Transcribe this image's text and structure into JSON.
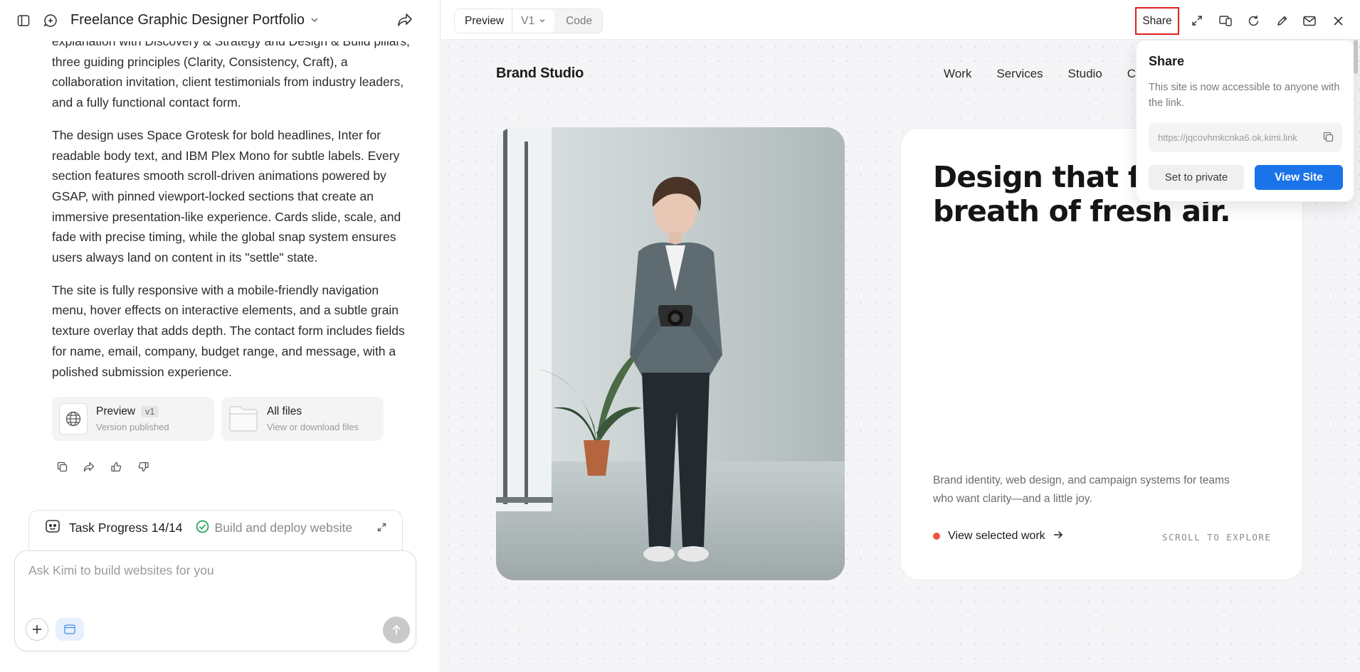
{
  "project": {
    "title": "Freelance Graphic Designer Portfolio"
  },
  "chat": {
    "paragraphs": [
      "explanation with Discovery & Strategy and Design & Build pillars, three guiding principles (Clarity, Consistency, Craft), a collaboration invitation, client testimonials from industry leaders, and a fully functional contact form.",
      "The design uses Space Grotesk for bold headlines, Inter for readable body text, and IBM Plex Mono for subtle labels. Every section features smooth scroll-driven animations powered by GSAP, with pinned viewport-locked sections that create an immersive presentation-like experience. Cards slide, scale, and fade with precise timing, while the global snap system ensures users always land on content in its \"settle\" state.",
      "The site is fully responsive with a mobile-friendly navigation menu, hover effects on interactive elements, and a subtle grain texture overlay that adds depth. The contact form includes fields for name, email, company, budget range, and message, with a polished submission experience."
    ],
    "cards": [
      {
        "title": "Preview",
        "badge": "v1",
        "subtitle": "Version published"
      },
      {
        "title": "All files",
        "subtitle": "View or download files"
      }
    ]
  },
  "task": {
    "label": "Task Progress 14/14",
    "status": "Build and deploy website"
  },
  "composer": {
    "placeholder": "Ask Kimi to build websites for you"
  },
  "toolbar": {
    "preview_label": "Preview",
    "version_label": "V1",
    "code_label": "Code",
    "share_label": "Share"
  },
  "site": {
    "brand": "Brand Studio",
    "nav": [
      "Work",
      "Services",
      "Studio",
      "Co"
    ],
    "hero_title": "Design that fe\nbreath of fresh air.",
    "hero_subtitle": "Brand identity, web design, and campaign systems for teams who want clarity—and a little joy.",
    "cta": "View selected work",
    "scroll_hint": "SCROLL TO EXPLORE",
    "colors": {
      "accent_dot": "#f0553a"
    }
  },
  "share_popover": {
    "title": "Share",
    "description": "This site is now accessible to anyone with the link.",
    "link": "https://jqcovhmkcnka6.ok.kimi.link",
    "private_button": "Set to private",
    "view_button": "View Site",
    "colors": {
      "primary": "#1a73e8"
    }
  }
}
